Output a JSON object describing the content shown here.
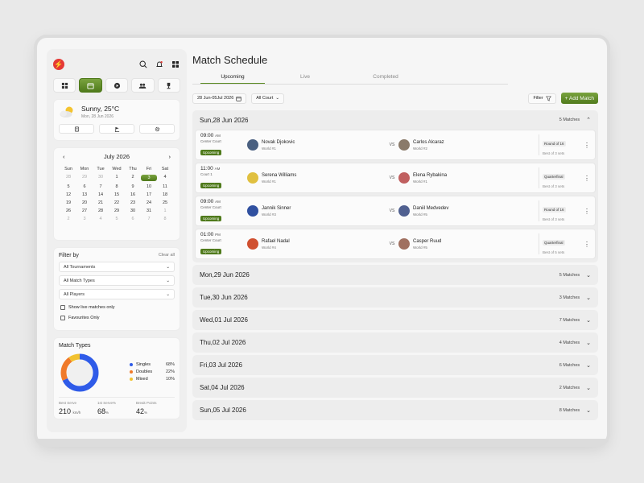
{
  "sidebar": {
    "weather": {
      "title": "Sunny, 25°C",
      "date": "Mon, 28 Jun 2026"
    },
    "calendar": {
      "month": "July 2026",
      "prev": "‹",
      "next": "›",
      "dows": [
        "Sun",
        "Mon",
        "Tue",
        "Wed",
        "Thu",
        "Fri",
        "Sat"
      ],
      "weeks": [
        [
          {
            "d": "28",
            "m": true
          },
          {
            "d": "29",
            "m": true
          },
          {
            "d": "30",
            "m": true
          },
          {
            "d": "1"
          },
          {
            "d": "2"
          },
          {
            "d": "3",
            "sel": true
          },
          {
            "d": "4"
          }
        ],
        [
          {
            "d": "5"
          },
          {
            "d": "6"
          },
          {
            "d": "7"
          },
          {
            "d": "8"
          },
          {
            "d": "9"
          },
          {
            "d": "10"
          },
          {
            "d": "11"
          }
        ],
        [
          {
            "d": "12"
          },
          {
            "d": "13"
          },
          {
            "d": "14"
          },
          {
            "d": "15"
          },
          {
            "d": "16"
          },
          {
            "d": "17"
          },
          {
            "d": "18"
          }
        ],
        [
          {
            "d": "19"
          },
          {
            "d": "20"
          },
          {
            "d": "21"
          },
          {
            "d": "22"
          },
          {
            "d": "23"
          },
          {
            "d": "24"
          },
          {
            "d": "25"
          }
        ],
        [
          {
            "d": "26"
          },
          {
            "d": "27"
          },
          {
            "d": "28"
          },
          {
            "d": "29"
          },
          {
            "d": "30"
          },
          {
            "d": "31"
          },
          {
            "d": "1",
            "m": true
          }
        ],
        [
          {
            "d": "2",
            "m": true
          },
          {
            "d": "3",
            "m": true
          },
          {
            "d": "4",
            "m": true
          },
          {
            "d": "5",
            "m": true
          },
          {
            "d": "6",
            "m": true
          },
          {
            "d": "7",
            "m": true
          },
          {
            "d": "8",
            "m": true
          }
        ]
      ]
    },
    "filters": {
      "title": "Filter by",
      "clear": "Clear all",
      "selects": [
        "All Tournaments",
        "All Match Types",
        "All Players"
      ],
      "checks": [
        "Show live matches only",
        "Favourites Only"
      ]
    },
    "match_types": {
      "title": "Match Types",
      "items": [
        {
          "label": "Singles",
          "value": "68%",
          "color": "#2f5be8"
        },
        {
          "label": "Doubles",
          "value": "22%",
          "color": "#f07a2a"
        },
        {
          "label": "Mixed",
          "value": "10%",
          "color": "#f2c230"
        }
      ],
      "stats": [
        {
          "label": "Best Serve",
          "value": "210",
          "unit": "km/h"
        },
        {
          "label": "1st Serve%",
          "value": "68",
          "unit": "%"
        },
        {
          "label": "Break Points",
          "value": "42",
          "unit": "%"
        }
      ]
    }
  },
  "main": {
    "title": "Match Schedule",
    "tabs": [
      "Upcoming",
      "Live",
      "Completed"
    ],
    "date_range": "28 Jun-05Jul 2026",
    "court": "All Court",
    "filter": "Filter",
    "add": "+ Add Match",
    "open_day": {
      "label": "Sun,28 Jun 2026",
      "count": "5 Matches",
      "matches": [
        {
          "time": "09:00",
          "ampm": "AM",
          "court": "Center Court",
          "status": "Upcoming",
          "p1": "Novak Djokovic",
          "r1": "World #1",
          "c1": "#4a6080",
          "p2": "Carlos Alcaraz",
          "r2": "World #2",
          "c2": "#8a7a6a",
          "round": "Round of 16",
          "sets": "Best of 3 sets"
        },
        {
          "time": "11:00",
          "ampm": "AM",
          "court": "Court 1",
          "status": "Upcoming",
          "p1": "Serena Williams",
          "r1": "World #1",
          "c1": "#e0c040",
          "p2": "Elena Rybakina",
          "r2": "World #1",
          "c2": "#c06060",
          "round": "Quarterfinal",
          "sets": "Best of 3 sets"
        },
        {
          "time": "09:00",
          "ampm": "AM",
          "court": "Center Court",
          "status": "Upcoming",
          "p1": "Jannik Sinner",
          "r1": "World #3",
          "c1": "#3050a0",
          "p2": "Daniil Medvedev",
          "r2": "World #5",
          "c2": "#506090",
          "round": "Round of 16",
          "sets": "Best of 3 sets"
        },
        {
          "time": "01:00",
          "ampm": "PM",
          "court": "Center Court",
          "status": "Upcoming",
          "p1": "Rafael Nadal",
          "r1": "World #4",
          "c1": "#d05030",
          "p2": "Casper Ruud",
          "r2": "World #5",
          "c2": "#a07060",
          "round": "Quarterfinal",
          "sets": "Best of 5 sets"
        }
      ]
    },
    "days": [
      {
        "label": "Mon,29 Jun 2026",
        "count": "5 Matches"
      },
      {
        "label": "Tue,30 Jun 2026",
        "count": "3 Matches"
      },
      {
        "label": "Wed,01 Jul 2026",
        "count": "7 Matches"
      },
      {
        "label": "Thu,02 Jul 2026",
        "count": "4 Matches"
      },
      {
        "label": "Fri,03 Jul 2026",
        "count": "6 Matches"
      },
      {
        "label": "Sat,04 Jul 2026",
        "count": "2 Matches"
      },
      {
        "label": "Sun,05 Jul 2026",
        "count": "8 Matches"
      }
    ]
  }
}
